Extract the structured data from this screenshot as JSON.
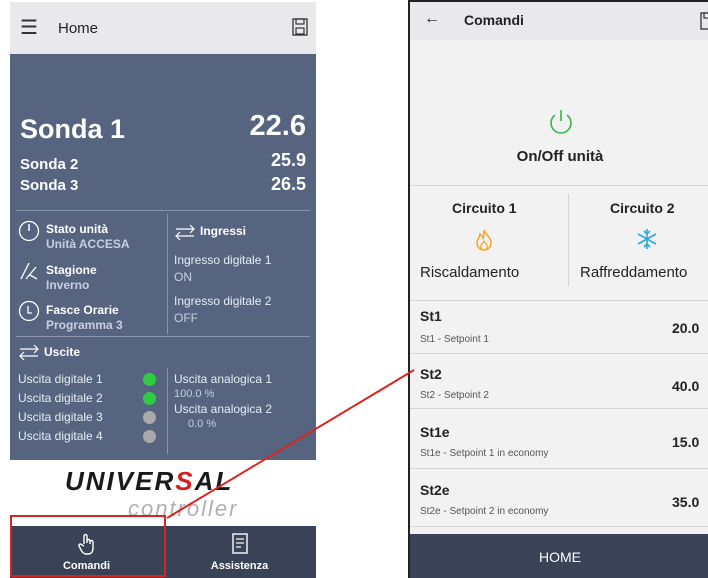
{
  "left": {
    "header_title": "Home",
    "sonda1_label": "Sonda 1",
    "sonda1_value": "22.6",
    "sonda2_label": "Sonda 2",
    "sonda2_value": "25.9",
    "sonda3_label": "Sonda 3",
    "sonda3_value": "26.5",
    "stato_label": "Stato unità",
    "stato_value": "Unità ACCESA",
    "stagione_label": "Stagione",
    "stagione_value": "Inverno",
    "fasce_label": "Fasce Orarie",
    "fasce_value": "Programma 3",
    "ingressi_label": "Ingressi",
    "ingresso1_label": "Ingresso digitale 1",
    "ingresso1_value": "ON",
    "ingresso2_label": "Ingresso digitale 2",
    "ingresso2_value": "OFF",
    "uscite_label": "Uscite",
    "uscite_digitali": [
      {
        "label": "Uscita digitale 1",
        "color": "#2ecc40"
      },
      {
        "label": "Uscita digitale 2",
        "color": "#2ecc40"
      },
      {
        "label": "Uscita digitale 3",
        "color": "#a9a9a9"
      },
      {
        "label": "Uscita digitale 4",
        "color": "#a9a9a9"
      }
    ],
    "analogica1_label": "Uscita analogica 1",
    "analogica1_value": "100.0 %",
    "analogica2_label": "Uscita analogica 2",
    "analogica2_value": "0.0 %",
    "logo_top_a": "UNIVER",
    "logo_top_b": "S",
    "logo_top_c": "AL",
    "logo_bottom": "controller",
    "footer_comandi": "Comandi",
    "footer_assistenza": "Assistenza"
  },
  "right": {
    "header_title": "Comandi",
    "onoff_label": "On/Off unità",
    "circuito1_title": "Circuito 1",
    "circuito1_mode": "Riscaldamento",
    "circuito2_title": "Circuito 2",
    "circuito2_mode": "Raffreddamento",
    "setpoints": [
      {
        "name": "St1",
        "desc": "St1 - Setpoint 1",
        "value": "20.0"
      },
      {
        "name": "St2",
        "desc": "St2 - Setpoint 2",
        "value": "40.0"
      },
      {
        "name": "St1e",
        "desc": "St1e - Setpoint 1 in economy",
        "value": "15.0"
      },
      {
        "name": "St2e",
        "desc": "St2e - Setpoint 2 in economy",
        "value": "35.0"
      }
    ],
    "footer_label": "HOME"
  },
  "colors": {
    "accent_red": "#d9241f",
    "flame": "#f5a623",
    "snow": "#2aa8e0",
    "onoff": "#3cb34a"
  }
}
